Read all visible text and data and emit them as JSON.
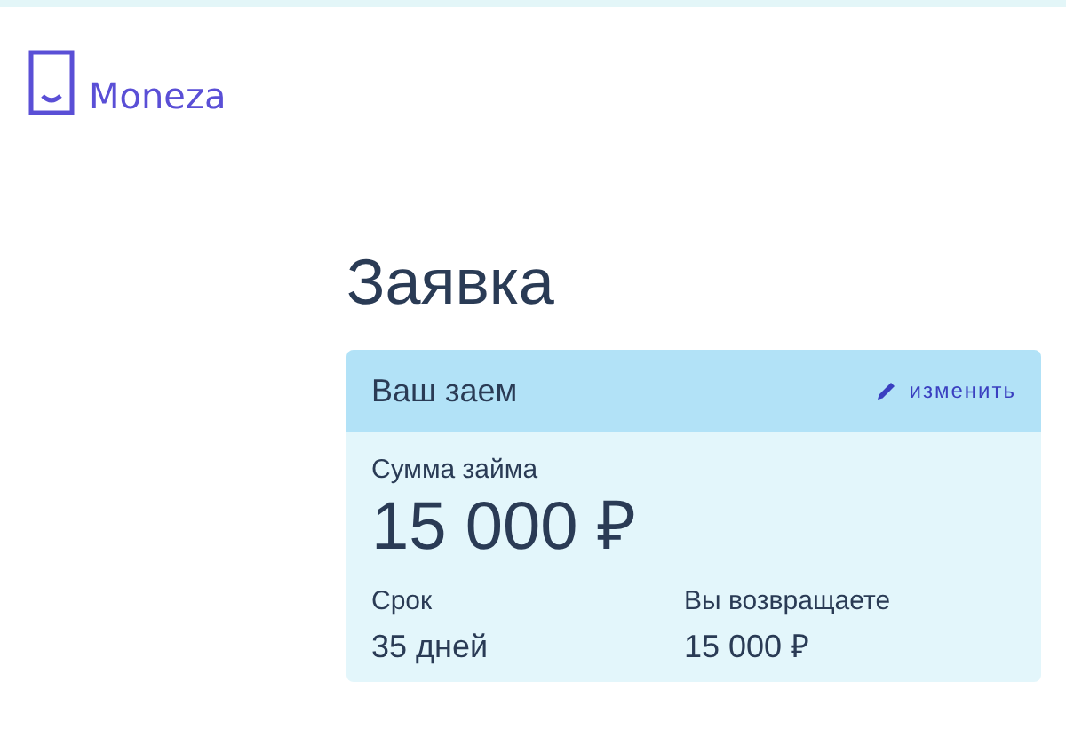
{
  "logo": {
    "text": "Moneza"
  },
  "page_title": "Заявка",
  "loan_card": {
    "title": "Ваш заем",
    "edit_link": "изменить",
    "amount": {
      "label": "Сумма займа",
      "value": "15 000 ₽"
    },
    "details": [
      {
        "label": "Срок",
        "value": "35 дней"
      },
      {
        "label": "Вы возвращаете",
        "value": "15 000 ₽"
      }
    ]
  }
}
